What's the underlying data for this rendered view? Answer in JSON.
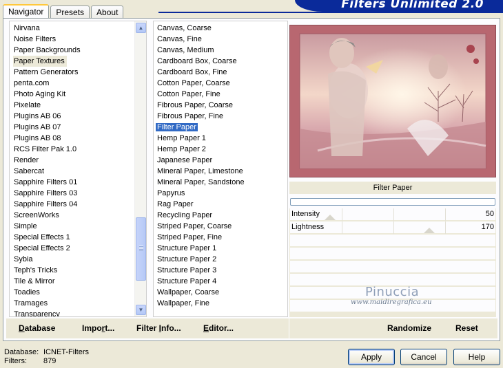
{
  "tabs": [
    {
      "label": "Navigator",
      "active": true
    },
    {
      "label": "Presets",
      "active": false
    },
    {
      "label": "About",
      "active": false
    }
  ],
  "banner": {
    "title": "Filters Unlimited 2.0"
  },
  "categories": {
    "items": [
      "Nirvana",
      "Noise Filters",
      "Paper Backgrounds",
      "Paper Textures",
      "Pattern Generators",
      "penta.com",
      "Photo Aging Kit",
      "Pixelate",
      "Plugins AB 06",
      "Plugins AB 07",
      "Plugins AB 08",
      "RCS Filter Pak 1.0",
      "Render",
      "Sabercat",
      "Sapphire Filters 01",
      "Sapphire Filters 03",
      "Sapphire Filters 04",
      "ScreenWorks",
      "Simple",
      "Special Effects 1",
      "Special Effects 2",
      "Sybia",
      "Teph's Tricks",
      "Tile & Mirror",
      "Toadies",
      "Tramages",
      "Transparency"
    ],
    "selected": "Paper Textures"
  },
  "filters": {
    "items": [
      "Canvas, Coarse",
      "Canvas, Fine",
      "Canvas, Medium",
      "Cardboard Box, Coarse",
      "Cardboard Box, Fine",
      "Cotton Paper, Coarse",
      "Cotton Paper, Fine",
      "Fibrous Paper, Coarse",
      "Fibrous Paper, Fine",
      "Filter Paper",
      "Hemp Paper 1",
      "Hemp Paper 2",
      "Japanese Paper",
      "Mineral Paper, Limestone",
      "Mineral Paper, Sandstone",
      "Papyrus",
      "Rag Paper",
      "Recycling Paper",
      "Striped Paper, Coarse",
      "Striped Paper, Fine",
      "Structure Paper 1",
      "Structure Paper 2",
      "Structure Paper 3",
      "Structure Paper 4",
      "Wallpaper, Coarse",
      "Wallpaper, Fine"
    ],
    "selected": "Filter Paper"
  },
  "panel_buttons": {
    "database": "Database",
    "import": "Import...",
    "filter_info": "Filter Info...",
    "editor": "Editor...",
    "randomize": "Randomize",
    "reset": "Reset"
  },
  "preview": {
    "filter_name": "Filter Paper",
    "progress": 0
  },
  "params": [
    {
      "label": "Intensity",
      "value": "50"
    },
    {
      "label": "Lightness",
      "value": "170"
    }
  ],
  "watermark": {
    "name": "Pinuccia",
    "url": "www.maidiregrafica.eu"
  },
  "status": {
    "database_label": "Database:",
    "database_value": "ICNET-Filters",
    "filters_label": "Filters:",
    "filters_value": "879"
  },
  "dialog_buttons": {
    "apply": "Apply",
    "cancel": "Cancel",
    "help": "Help"
  },
  "colors": {
    "selection": "#316ac5",
    "banner": "#0a2a9a",
    "preview_bg": "#b86770"
  }
}
